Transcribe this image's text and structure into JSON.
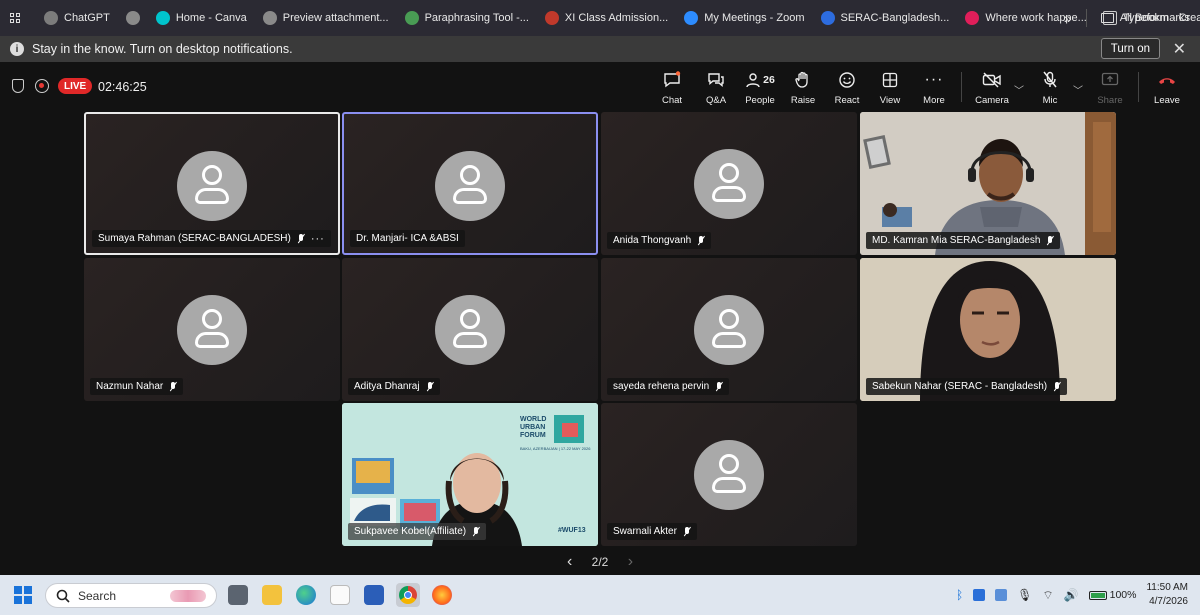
{
  "bookmarks": {
    "items": [
      {
        "label": "ChatGPT",
        "icon": "chatgpt-icon",
        "color": "#7c7c7c"
      },
      {
        "label": "",
        "icon": "globe-icon",
        "color": "#8a8a8a"
      },
      {
        "label": "Home - Canva",
        "icon": "canva-icon",
        "color": "#00c4cc"
      },
      {
        "label": "Preview attachment...",
        "icon": "globe-icon",
        "color": "#8a8a8a"
      },
      {
        "label": "Paraphrasing Tool -...",
        "icon": "quillbot-icon",
        "color": "#499c54"
      },
      {
        "label": "XI Class Admission...",
        "icon": "crest-icon",
        "color": "#c0392b"
      },
      {
        "label": "My Meetings - Zoom",
        "icon": "zoom-icon",
        "color": "#2d8cff"
      },
      {
        "label": "SERAC-Bangladesh...",
        "icon": "serac-icon",
        "color": "#2d6cdf"
      },
      {
        "label": "Where work happe...",
        "icon": "slack-icon",
        "color": "#e01e5a"
      },
      {
        "label": "Typeform - Create",
        "icon": "typeform-icon",
        "color": "#ffffff"
      }
    ],
    "more": "»",
    "all_bookmarks": "All Bookmarks"
  },
  "notification": {
    "text": "Stay in the know. Turn on desktop notifications.",
    "button": "Turn on",
    "close": "✕"
  },
  "meeting": {
    "live": "LIVE",
    "timer": "02:46:25",
    "toolbar": {
      "chat": "Chat",
      "qa": "Q&A",
      "people": "People",
      "people_count": "26",
      "raise": "Raise",
      "react": "React",
      "view": "View",
      "more": "More",
      "camera": "Camera",
      "mic": "Mic",
      "share": "Share",
      "leave": "Leave"
    }
  },
  "participants": [
    {
      "name": "Sumaya Rahman (SERAC-BANGLADESH)",
      "video": false,
      "muted": true,
      "more": "···"
    },
    {
      "name": "Dr. Manjari- ICA &ABSI",
      "video": false,
      "muted": false
    },
    {
      "name": "Anida Thongvanh",
      "video": false,
      "muted": true
    },
    {
      "name": "MD. Kamran Mia SERAC-Bangladesh",
      "video": true,
      "muted": true
    },
    {
      "name": "Nazmun Nahar",
      "video": false,
      "muted": true
    },
    {
      "name": "Aditya Dhanraj",
      "video": false,
      "muted": true
    },
    {
      "name": "sayeda rehena pervin",
      "video": false,
      "muted": true
    },
    {
      "name": "Sabekun Nahar (SERAC - Bangladesh)",
      "video": true,
      "muted": true
    },
    {
      "name": "Sukpavee Kobel(Affiliate)",
      "video": true,
      "muted": true
    },
    {
      "name": "Swarnali Akter",
      "video": false,
      "muted": true
    }
  ],
  "wuf": {
    "line1": "WORLD",
    "line2": "URBAN",
    "line3": "FORUM",
    "tagline": "BAKU, AZERBAIJAN | 17-22 MAY 2026",
    "hashtag": "#WUF13"
  },
  "pager": {
    "prev": "‹",
    "label": "2/2",
    "next": "›"
  },
  "taskbar": {
    "search_placeholder": "Search",
    "battery": "100%",
    "time": "11:50 AM",
    "date": "4/7/2026"
  }
}
